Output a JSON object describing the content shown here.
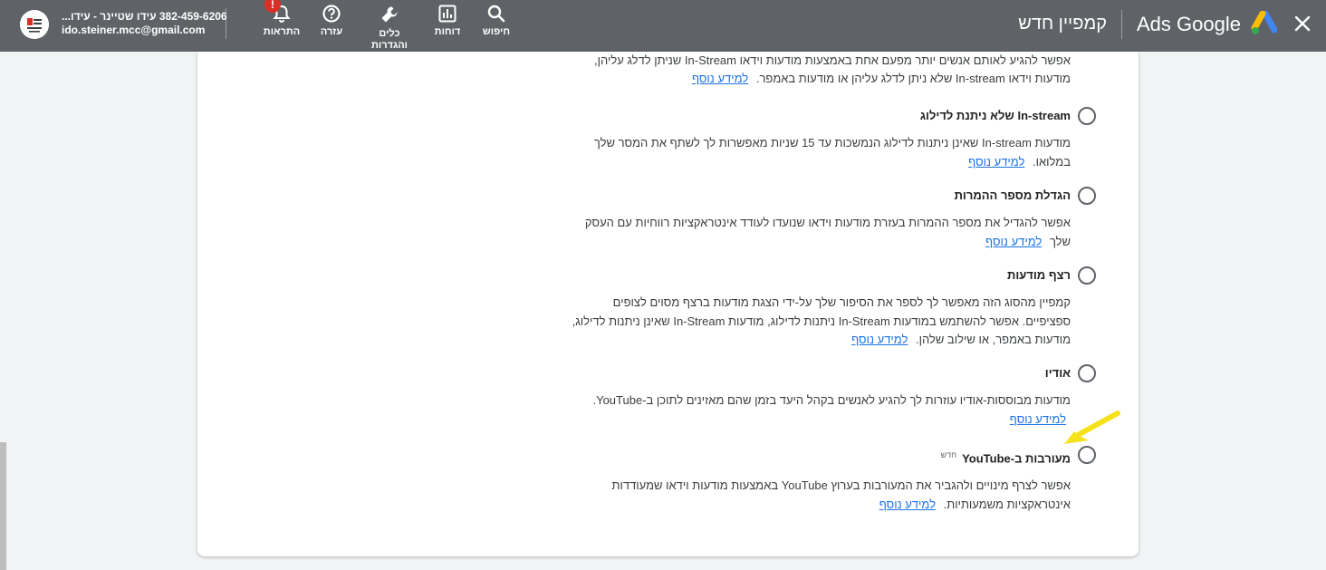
{
  "header": {
    "close_icon": "close-icon",
    "logo_icon": "google-ads-logo-icon",
    "product_name": "Ads Google",
    "page_title": "קמפיין חדש",
    "tools": [
      {
        "key": "search",
        "icon": "search-icon",
        "label": "חיפוש"
      },
      {
        "key": "reports",
        "icon": "bar-chart-icon",
        "label": "דוחות"
      },
      {
        "key": "tools",
        "icon": "wrench-icon",
        "label": "כלים והגדרות"
      },
      {
        "key": "help",
        "icon": "help-icon",
        "label": "עזרה"
      },
      {
        "key": "notifications",
        "icon": "bell-icon",
        "label": "התראות",
        "badge": "!"
      }
    ],
    "account": {
      "name": "382-459-6206 עידו שטיינר - עידו...",
      "email": "ido.steiner.mcc@gmail.com",
      "avatar_icon": "account-avatar-icon"
    }
  },
  "content": {
    "intro_text": "אפשר להגיע לאותם אנשים יותר מפעם אחת באמצעות מודעות וידאו In-Stream שניתן לדלג עליהן, מודעות וידאו In-stream שלא ניתן לדלג עליהן או מודעות באמפר.",
    "learn_more": "למידע נוסף",
    "options": [
      {
        "title": "In-stream שלא ניתנת לדילוג",
        "description": "מודעות In-stream שאינן ניתנות לדילוג הנמשכות עד 15 שניות מאפשרות לך לשתף את המסר שלך במלואו.",
        "selected": false
      },
      {
        "title": "הגדלת מספר ההמרות",
        "description": "אפשר להגדיל את מספר ההמרות בעזרת מודעות וידאו שנועדו לעודד אינטראקציות רווחיות עם העסק שלך",
        "selected": false
      },
      {
        "title": "רצף מודעות",
        "description": "קמפיין מהסוג הזה מאפשר לך לספר את הסיפור שלך על-ידי הצגת מודעות ברצף מסוים לצופים ספציפיים. אפשר להשתמש במודעות In-Stream ניתנות לדילוג, מודעות In-Stream שאינן ניתנות לדילוג, מודעות באמפר, או שילוב שלהן.",
        "selected": false
      },
      {
        "title": "אודיו",
        "description": "מודעות מבוססות-אודיו עוזרות לך להגיע לאנשים בקהל היעד בזמן שהם מאזינים לתוכן ב-YouTube.",
        "selected": false
      },
      {
        "title": "מעורבות ב-YouTube",
        "tag": "חדש",
        "description": "אפשר לצרף מינויים ולהגביר את המעורבות בערוץ YouTube באמצעות מודעות וידאו שמעודדות אינטראקציות משמעותיות.",
        "selected": false
      }
    ],
    "annotation": "yellow-arrow-icon"
  },
  "colors": {
    "header_bg": "#5f6368",
    "link": "#1a73e8",
    "arrow": "#f5e21a",
    "badge": "#d93025"
  }
}
